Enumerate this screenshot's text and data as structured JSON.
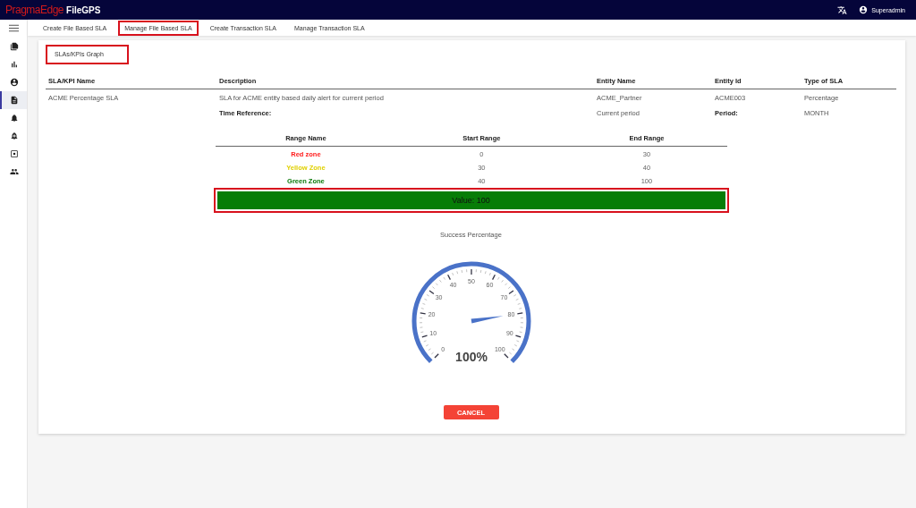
{
  "app": {
    "brand": "PragmaEdge",
    "product": "FileGPS",
    "user": "Superadmin"
  },
  "sidebar": {
    "items": [
      {
        "selected": false
      },
      {
        "selected": false
      },
      {
        "selected": false
      },
      {
        "selected": true
      },
      {
        "selected": false
      },
      {
        "selected": false
      },
      {
        "selected": false
      },
      {
        "selected": false
      }
    ]
  },
  "tabs": [
    {
      "label": "Create File Based SLA",
      "selected": false
    },
    {
      "label": "Manage File Based SLA",
      "selected": true
    },
    {
      "label": "Create Transaction SLA",
      "selected": false
    },
    {
      "label": "Manage Transaction SLA",
      "selected": false
    }
  ],
  "card": {
    "title": "SLAs/KPIs Graph",
    "table": {
      "columns": [
        "SLA/KPI Name",
        "Description",
        "Entity Name",
        "Entity Id",
        "Type of SLA"
      ],
      "rows": [
        {
          "cells": [
            "ACME Percentage SLA",
            "SLA for ACME entity based daily alert for current period",
            "ACME_Partner",
            "ACME003",
            "Percentage"
          ]
        }
      ],
      "details": {
        "time_label": "Time Reference:",
        "time_value": "Current period",
        "period_label": "Period:",
        "period_value": "MONTH"
      }
    },
    "ranges": {
      "columns": [
        "Range Name",
        "Start Range",
        "End Range"
      ],
      "rows": [
        {
          "name": "Red zone",
          "color": "#ff1a1a",
          "start": "0",
          "end": "30"
        },
        {
          "name": "Yellow Zone",
          "color": "#e0d000",
          "start": "30",
          "end": "40"
        },
        {
          "name": "Green Zone",
          "color": "#0a7a0a",
          "start": "40",
          "end": "100"
        }
      ]
    },
    "value_bar": {
      "text": "Value: 100",
      "color": "#077d07"
    },
    "gauge": {
      "title": "Success Percentage",
      "labels": [
        "0",
        "10",
        "20",
        "30",
        "40",
        "50",
        "60",
        "70",
        "80",
        "90",
        "100"
      ],
      "reading": "100%"
    },
    "cancel": "CANCEL"
  }
}
